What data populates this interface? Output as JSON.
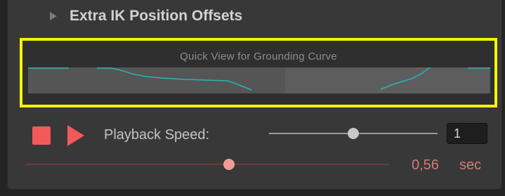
{
  "foldout": {
    "label": "Extra IK Position Offsets",
    "icon": "triangle-right-icon"
  },
  "curve_preview": {
    "title": "Quick View for Grounding Curve",
    "highlight_color": "#f5f500",
    "curve_color": "#2ab3b3"
  },
  "playback": {
    "stop_icon": "stop-square-icon",
    "play_icon": "play-triangle-icon",
    "accent_color": "#f25a5a",
    "speed_label": "Playback Speed:",
    "speed_value": "1",
    "speed_slider_fraction": 0.5,
    "time_value": "0,56",
    "time_unit": "sec",
    "time_slider_fraction": 0.56
  }
}
